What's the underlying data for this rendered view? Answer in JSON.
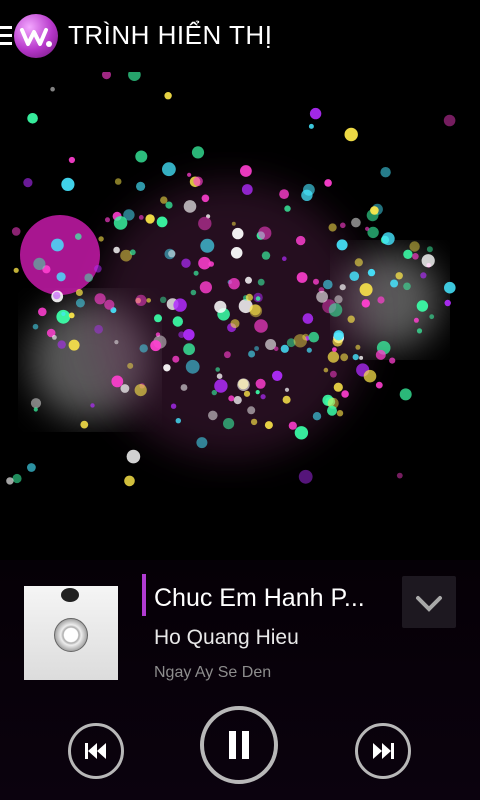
{
  "header": {
    "title": "TRÌNH HIỂN THỊ",
    "menu_icon": "menu-icon",
    "logo_icon": "walkman-logo-icon"
  },
  "visualizer": {
    "type": "particle-visualizer",
    "colors": [
      "#ff3fd0",
      "#b22cff",
      "#3bffa8",
      "#ffe94a",
      "#46e6ff",
      "#ffffff"
    ]
  },
  "now_playing": {
    "title": "Chuc Em Hanh P...",
    "artist": "Ho Quang Hieu",
    "album": "Ngay Ay Se Den",
    "accent_color": "#b03bd1"
  },
  "controls": {
    "collapse_icon": "chevron-down-icon",
    "prev_icon": "skip-previous-icon",
    "pause_icon": "pause-icon",
    "next_icon": "skip-next-icon"
  }
}
